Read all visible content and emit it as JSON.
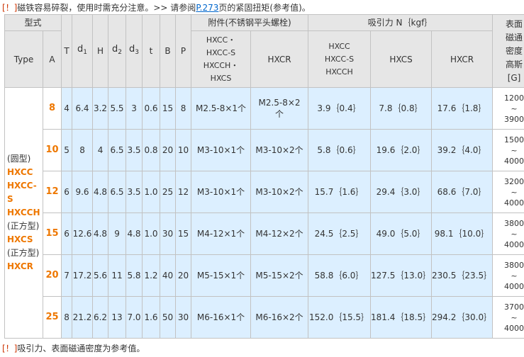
{
  "notes": {
    "top_mark": "[！]",
    "top_text": "磁铁容易碎裂，使用时需充分注意。>> 请参阅",
    "top_link": "P.273",
    "top_after": "页的紧固扭矩(参考值)。",
    "bottom_mark": "[！]",
    "bottom_text": "吸引力、表面磁通密度为参考值。"
  },
  "header": {
    "model_group": "型式",
    "type": "Type",
    "a": "A",
    "t_upper": "T",
    "d1": "d",
    "d1_sub": "1",
    "h": "H",
    "d2": "d",
    "d2_sub": "2",
    "d3": "d",
    "d3_sub": "3",
    "t_lower": "t",
    "b": "B",
    "p": "P",
    "accessory_group": "附件(不锈钢平头螺栓)",
    "acc_col1": "HXCC・\nHXCC-S\nHXCCH・\nHXCS",
    "acc_col2": "HXCR",
    "force_group": "吸引力 N｛kgf｝",
    "force_col1": "HXCC\nHXCC-S\nHXCCH",
    "force_col2": "HXCS",
    "force_col3": "HXCR",
    "flux": "表面\n磁通\n密度\n高斯\n[G]"
  },
  "type_lines": [
    {
      "text": "(圆型)",
      "style": "normal"
    },
    {
      "text": "HXCC",
      "style": "orange"
    },
    {
      "text": "HXCC-",
      "style": "orange"
    },
    {
      "text": "S",
      "style": "orange"
    },
    {
      "text": "HXCCH",
      "style": "orange"
    },
    {
      "text": "(正方型)",
      "style": "normal"
    },
    {
      "text": "HXCS",
      "style": "orange"
    },
    {
      "text": "(正方型)",
      "style": "normal"
    },
    {
      "text": "HXCR",
      "style": "orange"
    }
  ],
  "rows": [
    {
      "a": "8",
      "T": "4",
      "d1": "6.4",
      "H": "3.2",
      "d2": "5.5",
      "d3": "3",
      "t": "0.6",
      "B": "15",
      "P": "8",
      "acc1": "M2.5-8×1个",
      "acc2": "M2.5-8×2个",
      "f1": "3.9｛0.4｝",
      "f2": "7.8｛0.8｝",
      "f3": "17.6｛1.8｝",
      "flux_lo": "1200",
      "flux_sep": "~",
      "flux_hi": "3900"
    },
    {
      "a": "10",
      "T": "5",
      "d1": "8",
      "H": "4",
      "d2": "6.5",
      "d3": "3.5",
      "t": "0.8",
      "B": "20",
      "P": "10",
      "acc1": "M3-10×1个",
      "acc2": "M3-10×2个",
      "f1": "5.8｛0.6｝",
      "f2": "19.6｛2.0｝",
      "f3": "39.2｛4.0｝",
      "flux_lo": "1500",
      "flux_sep": "~",
      "flux_hi": "4000"
    },
    {
      "a": "12",
      "T": "6",
      "d1": "9.6",
      "H": "4.8",
      "d2": "6.5",
      "d3": "3.5",
      "t": "1.0",
      "B": "25",
      "P": "12",
      "acc1": "M3-10×1个",
      "acc2": "M3-10×2个",
      "f1": "15.7｛1.6｝",
      "f2": "29.4｛3.0｝",
      "f3": "68.6｛7.0｝",
      "flux_lo": "3200",
      "flux_sep": "~",
      "flux_hi": "4000"
    },
    {
      "a": "15",
      "T": "6",
      "d1": "12.6",
      "H": "4.8",
      "d2": "9",
      "d3": "4.8",
      "t": "1.0",
      "B": "30",
      "P": "15",
      "acc1": "M4-12×1个",
      "acc2": "M4-12×2个",
      "f1": "24.5｛2.5｝",
      "f2": "49.0｛5.0｝",
      "f3": "98.1｛10.0｝",
      "flux_lo": "3800",
      "flux_sep": "~",
      "flux_hi": "4000"
    },
    {
      "a": "20",
      "T": "7",
      "d1": "17.2",
      "H": "5.6",
      "d2": "11",
      "d3": "5.8",
      "t": "1.2",
      "B": "40",
      "P": "20",
      "acc1": "M5-15×1个",
      "acc2": "M5-15×2个",
      "f1": "58.8｛6.0｝",
      "f2": "127.5｛13.0｝",
      "f3": "230.5｛23.5｝",
      "flux_lo": "3800",
      "flux_sep": "~",
      "flux_hi": "4000"
    },
    {
      "a": "25",
      "T": "8",
      "d1": "21.2",
      "H": "6.2",
      "d2": "13",
      "d3": "7.0",
      "t": "1.6",
      "B": "50",
      "P": "30",
      "acc1": "M6-16×1个",
      "acc2": "M6-16×2个",
      "f1": "152.0｛15.5｝",
      "f2": "181.4｛18.5｝",
      "f3": "294.2｛30.0｝",
      "flux_lo": "3700",
      "flux_sep": "~",
      "flux_hi": "4000"
    }
  ],
  "colors": {
    "warning": "#cc3300",
    "link": "#0066cc",
    "highlight": "#ee7700",
    "cell_bg": "#dcefff",
    "header_bg": "#e6e6e6"
  }
}
